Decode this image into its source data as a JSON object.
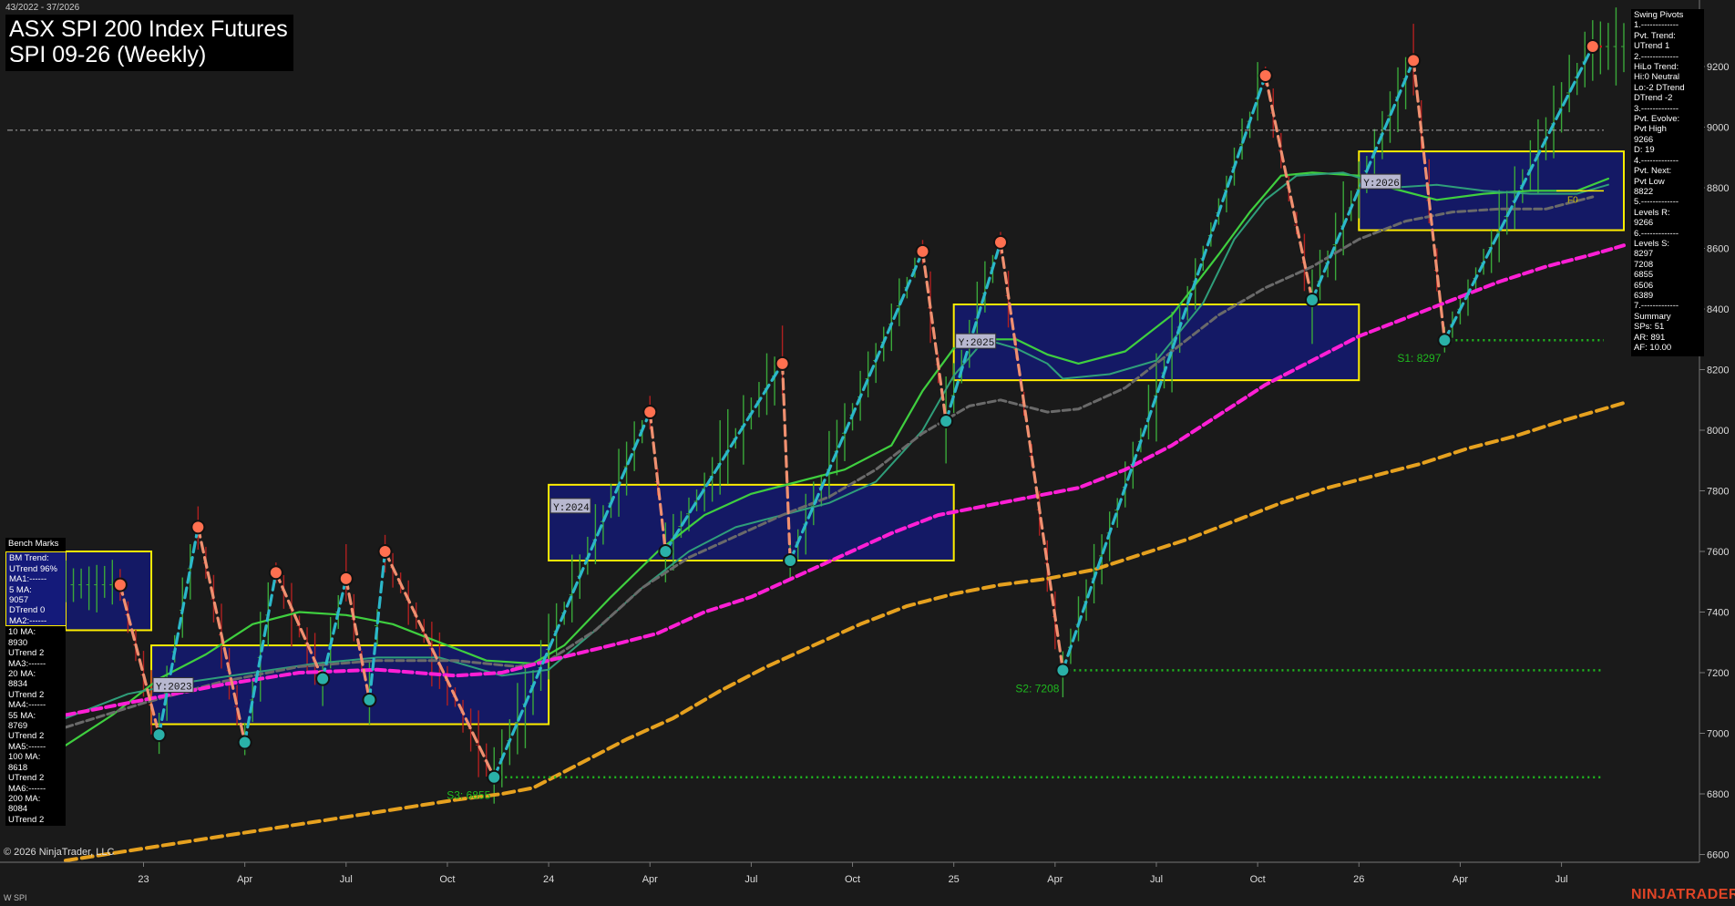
{
  "header": {
    "date_range": "43/2022 - 37/2026",
    "title_line1": "ASX SPI 200 Index Futures",
    "title_line2": "SPI 09-26 (Weekly)"
  },
  "footer": {
    "copyright": "© 2026 NinjaTrader, LLC",
    "symbol": "W SPI",
    "brand": "NINJATRADER"
  },
  "colors": {
    "background": "#1a1a1a",
    "ma_fast_green": "#3fcf3f",
    "ma_teal": "#2f9e7a",
    "ma_gray": "#6a6a6a",
    "ma_magenta": "#ff1fd6",
    "ma_orange": "#e6a11f",
    "zone_fill": "#141a6e",
    "zone_border": "#ffee00",
    "swing_up": "#2bb7c9",
    "swing_down": "#f09070",
    "pivot_high": "#ff7050",
    "pivot_low": "#2ab0a8",
    "support_line": "#1fb81f",
    "resistance_line": "#e01818",
    "bar_up": "#3aa83a",
    "bar_down": "#b02020"
  },
  "benchmarks": {
    "header": "Bench Marks",
    "blue_lines": [
      "BM Trend:",
      "UTrend 96%",
      "MA1:------",
      "5 MA:",
      "9057",
      "DTrend 0",
      "MA2:------"
    ],
    "lines": [
      "10 MA:",
      "8930",
      "UTrend 2",
      "MA3:------",
      "20 MA:",
      "8834",
      "UTrend 2",
      "MA4:------",
      "55 MA:",
      "8769",
      "UTrend 2",
      "MA5:------",
      "100 MA:",
      "8618",
      "UTrend 2",
      "MA6:------",
      "200 MA:",
      "8084",
      "UTrend 2"
    ]
  },
  "swing_pivots": {
    "lines": [
      "Swing Pivots",
      "1.-------------",
      "Pvt. Trend:",
      "UTrend 1",
      "2.-------------",
      "HiLo Trend:",
      "Hi:0 Neutral",
      "Lo:-2 DTrend",
      "DTrend -2",
      "3.-------------",
      "Pvt. Evolve:",
      "Pvt High",
      "9266",
      "D: 19",
      "4.-------------",
      "Pvt. Next:",
      "Pvt Low",
      "8822",
      "5.-------------",
      "Levels R:",
      "9266",
      "6.-------------",
      "Levels S:",
      "8297",
      "7208",
      "6855",
      "6506",
      "6389",
      "7.-------------",
      "Summary",
      "SPs: 51",
      "AR: 891",
      "AF: 10.00"
    ]
  },
  "chart_data": {
    "type": "line",
    "title": "ASX SPI 200 Index Futures",
    "subtitle": "SPI 09-26 (Weekly)",
    "ylim": [
      6570,
      9370
    ],
    "y_ticks": [
      6600,
      6800,
      7000,
      7200,
      7400,
      7600,
      7800,
      8000,
      8200,
      8400,
      8600,
      8800,
      9000,
      9200
    ],
    "x_axis": {
      "start_week": "2022-W43",
      "end_week": "2026-W37",
      "tick_labels": [
        "23",
        "Apr",
        "Jul",
        "Oct",
        "24",
        "Apr",
        "Jul",
        "Oct",
        "25",
        "Apr",
        "Jul",
        "Oct",
        "26",
        "Apr",
        "Jul"
      ],
      "tick_weeks": [
        10,
        23,
        36,
        49,
        62,
        75,
        88,
        101,
        114,
        127,
        140,
        153,
        166,
        179,
        192
      ]
    },
    "grid": false,
    "current_price_line": 8990,
    "yearly_zones": [
      {
        "label": "Y:2023",
        "week_start": 11,
        "week_end": 62,
        "low": 7030,
        "high": 7290
      },
      {
        "label": "Y:2024",
        "week_start": 62,
        "week_end": 114,
        "low": 7570,
        "high": 7820
      },
      {
        "label": "Y:2025",
        "week_start": 114,
        "week_end": 166,
        "low": 8165,
        "high": 8415
      },
      {
        "label": "Y:2026",
        "week_start": 166,
        "week_end": 200,
        "low": 8660,
        "high": 8920
      }
    ],
    "partial_zone_2022": {
      "week_start": 0,
      "week_end": 11,
      "low": 7340,
      "high": 7600
    },
    "swing_pivots": [
      {
        "week": 7,
        "value": 7490,
        "type": "high"
      },
      {
        "week": 12,
        "value": 6995,
        "type": "low"
      },
      {
        "week": 17,
        "value": 7680,
        "type": "high"
      },
      {
        "week": 23,
        "value": 6970,
        "type": "low"
      },
      {
        "week": 27,
        "value": 7530,
        "type": "high"
      },
      {
        "week": 33,
        "value": 7180,
        "type": "low"
      },
      {
        "week": 36,
        "value": 7510,
        "type": "high"
      },
      {
        "week": 39,
        "value": 7110,
        "type": "low"
      },
      {
        "week": 41,
        "value": 7600,
        "type": "high"
      },
      {
        "week": 55,
        "value": 6855,
        "type": "low"
      },
      {
        "week": 75,
        "value": 8060,
        "type": "high"
      },
      {
        "week": 77,
        "value": 7600,
        "type": "low"
      },
      {
        "week": 92,
        "value": 8220,
        "type": "high"
      },
      {
        "week": 93,
        "value": 7570,
        "type": "low"
      },
      {
        "week": 110,
        "value": 8590,
        "type": "high"
      },
      {
        "week": 113,
        "value": 8030,
        "type": "low"
      },
      {
        "week": 120,
        "value": 8620,
        "type": "high"
      },
      {
        "week": 128,
        "value": 7208,
        "type": "low"
      },
      {
        "week": 154,
        "value": 9170,
        "type": "high"
      },
      {
        "week": 160,
        "value": 8430,
        "type": "low"
      },
      {
        "week": 173,
        "value": 9220,
        "type": "high"
      },
      {
        "week": 177,
        "value": 8297,
        "type": "low"
      },
      {
        "week": 196,
        "value": 9266,
        "type": "high"
      }
    ],
    "support_levels": [
      {
        "label": "S1: 8297",
        "value": 8297,
        "from_week": 177
      },
      {
        "label": "S2: 7208",
        "value": 7208,
        "from_week": 128
      },
      {
        "label": "S3: 6855",
        "value": 6855,
        "from_week": 55
      }
    ],
    "resistance_levels": [
      {
        "value": 9266,
        "from_week": 196
      }
    ],
    "f0_marker": {
      "label": "F0",
      "value": 8790
    },
    "series": [
      {
        "key": "ma_fast_green",
        "label": "10 MA",
        "width": 2.2,
        "dash": "",
        "points": [
          [
            0,
            6960
          ],
          [
            6,
            7060
          ],
          [
            12,
            7180
          ],
          [
            18,
            7260
          ],
          [
            24,
            7360
          ],
          [
            30,
            7400
          ],
          [
            36,
            7390
          ],
          [
            42,
            7360
          ],
          [
            48,
            7300
          ],
          [
            54,
            7240
          ],
          [
            60,
            7230
          ],
          [
            64,
            7290
          ],
          [
            70,
            7450
          ],
          [
            76,
            7600
          ],
          [
            82,
            7720
          ],
          [
            88,
            7790
          ],
          [
            94,
            7830
          ],
          [
            100,
            7870
          ],
          [
            106,
            7950
          ],
          [
            110,
            8130
          ],
          [
            114,
            8270
          ],
          [
            118,
            8300
          ],
          [
            122,
            8300
          ],
          [
            126,
            8250
          ],
          [
            130,
            8220
          ],
          [
            136,
            8260
          ],
          [
            142,
            8380
          ],
          [
            148,
            8580
          ],
          [
            152,
            8720
          ],
          [
            156,
            8840
          ],
          [
            160,
            8850
          ],
          [
            166,
            8840
          ],
          [
            170,
            8800
          ],
          [
            176,
            8760
          ],
          [
            182,
            8780
          ],
          [
            188,
            8790
          ],
          [
            194,
            8790
          ],
          [
            198,
            8830
          ]
        ]
      },
      {
        "key": "ma_teal",
        "label": "20 MA",
        "width": 2,
        "dash": "",
        "points": [
          [
            0,
            7050
          ],
          [
            8,
            7130
          ],
          [
            16,
            7170
          ],
          [
            24,
            7200
          ],
          [
            32,
            7230
          ],
          [
            40,
            7250
          ],
          [
            48,
            7250
          ],
          [
            56,
            7190
          ],
          [
            62,
            7210
          ],
          [
            68,
            7340
          ],
          [
            74,
            7480
          ],
          [
            80,
            7600
          ],
          [
            86,
            7680
          ],
          [
            92,
            7720
          ],
          [
            98,
            7760
          ],
          [
            104,
            7830
          ],
          [
            110,
            8000
          ],
          [
            114,
            8180
          ],
          [
            118,
            8300
          ],
          [
            122,
            8270
          ],
          [
            126,
            8220
          ],
          [
            128,
            8170
          ],
          [
            134,
            8185
          ],
          [
            140,
            8230
          ],
          [
            146,
            8420
          ],
          [
            150,
            8630
          ],
          [
            154,
            8760
          ],
          [
            158,
            8840
          ],
          [
            164,
            8850
          ],
          [
            170,
            8800
          ],
          [
            176,
            8810
          ],
          [
            182,
            8790
          ],
          [
            188,
            8780
          ],
          [
            194,
            8780
          ],
          [
            198,
            8810
          ]
        ]
      },
      {
        "key": "ma_gray",
        "label": "55 MA",
        "width": 3,
        "dash": "8,4",
        "points": [
          [
            0,
            7020
          ],
          [
            10,
            7100
          ],
          [
            20,
            7170
          ],
          [
            30,
            7220
          ],
          [
            40,
            7240
          ],
          [
            50,
            7240
          ],
          [
            58,
            7220
          ],
          [
            62,
            7240
          ],
          [
            68,
            7340
          ],
          [
            74,
            7480
          ],
          [
            80,
            7580
          ],
          [
            86,
            7650
          ],
          [
            92,
            7720
          ],
          [
            98,
            7780
          ],
          [
            104,
            7870
          ],
          [
            110,
            7990
          ],
          [
            116,
            8080
          ],
          [
            120,
            8100
          ],
          [
            126,
            8060
          ],
          [
            130,
            8070
          ],
          [
            136,
            8140
          ],
          [
            142,
            8260
          ],
          [
            148,
            8380
          ],
          [
            154,
            8470
          ],
          [
            160,
            8540
          ],
          [
            166,
            8630
          ],
          [
            172,
            8690
          ],
          [
            178,
            8720
          ],
          [
            184,
            8730
          ],
          [
            190,
            8730
          ],
          [
            196,
            8770
          ]
        ]
      },
      {
        "key": "ma_magenta",
        "label": "100 MA",
        "width": 4,
        "dash": "10,5",
        "points": [
          [
            0,
            7060
          ],
          [
            10,
            7110
          ],
          [
            20,
            7160
          ],
          [
            30,
            7200
          ],
          [
            40,
            7210
          ],
          [
            50,
            7190
          ],
          [
            56,
            7200
          ],
          [
            62,
            7240
          ],
          [
            70,
            7290
          ],
          [
            76,
            7330
          ],
          [
            82,
            7400
          ],
          [
            88,
            7450
          ],
          [
            94,
            7520
          ],
          [
            100,
            7590
          ],
          [
            106,
            7660
          ],
          [
            112,
            7720
          ],
          [
            118,
            7750
          ],
          [
            124,
            7780
          ],
          [
            130,
            7810
          ],
          [
            136,
            7870
          ],
          [
            142,
            7950
          ],
          [
            148,
            8050
          ],
          [
            154,
            8150
          ],
          [
            160,
            8230
          ],
          [
            166,
            8310
          ],
          [
            172,
            8370
          ],
          [
            178,
            8430
          ],
          [
            184,
            8490
          ],
          [
            190,
            8540
          ],
          [
            196,
            8580
          ],
          [
            200,
            8610
          ]
        ]
      },
      {
        "key": "ma_orange",
        "label": "200 MA",
        "width": 4,
        "dash": "12,6",
        "points": [
          [
            0,
            6580
          ],
          [
            10,
            6620
          ],
          [
            20,
            6660
          ],
          [
            30,
            6700
          ],
          [
            40,
            6740
          ],
          [
            50,
            6780
          ],
          [
            56,
            6800
          ],
          [
            60,
            6820
          ],
          [
            66,
            6900
          ],
          [
            72,
            6980
          ],
          [
            78,
            7050
          ],
          [
            84,
            7140
          ],
          [
            90,
            7220
          ],
          [
            96,
            7290
          ],
          [
            102,
            7360
          ],
          [
            108,
            7420
          ],
          [
            114,
            7460
          ],
          [
            120,
            7490
          ],
          [
            126,
            7510
          ],
          [
            132,
            7540
          ],
          [
            138,
            7590
          ],
          [
            144,
            7640
          ],
          [
            150,
            7700
          ],
          [
            156,
            7760
          ],
          [
            162,
            7810
          ],
          [
            168,
            7850
          ],
          [
            174,
            7890
          ],
          [
            180,
            7940
          ],
          [
            186,
            7980
          ],
          [
            192,
            8030
          ],
          [
            196,
            8060
          ],
          [
            200,
            8090
          ]
        ]
      }
    ],
    "legend": "none"
  }
}
